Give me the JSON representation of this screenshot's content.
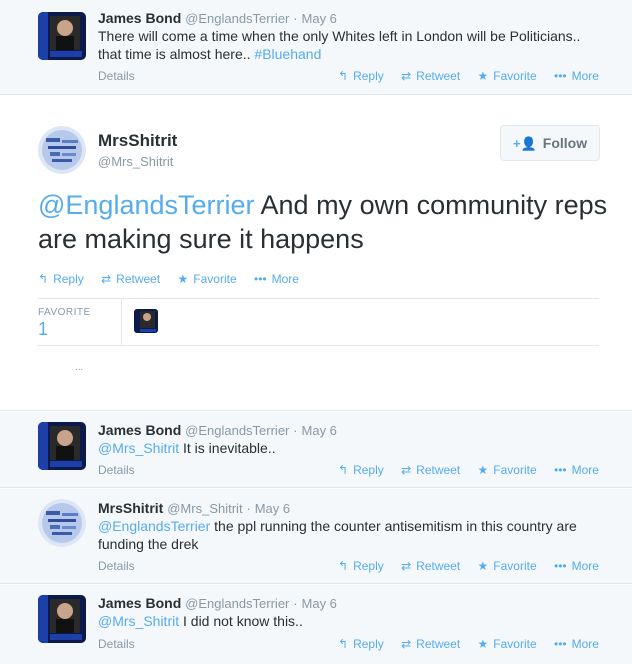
{
  "tweets_top": {
    "name": "James Bond",
    "handle": "@EnglandsTerrier",
    "sep": "·",
    "date": "May 6",
    "text_line1": "There will come a time when the only Whites left in London will be Politicians..",
    "text_line2": "that time is almost here.. ",
    "hashtag": "#Bluehand",
    "details": "Details"
  },
  "actions": {
    "reply": "Reply",
    "retweet": "Retweet",
    "favorite": "Favorite",
    "more": "More"
  },
  "main_tweet": {
    "name": "MrsShitrit",
    "handle": "@Mrs_Shitrit",
    "follow_label": "Follow",
    "mention": "@EnglandsTerrier",
    "text": " And my own community reps are making sure it happens",
    "favorite_label": "FAVORITE",
    "favorite_count": "1",
    "ellipsis": "..."
  },
  "reply1": {
    "name": "James Bond",
    "handle": "@EnglandsTerrier",
    "sep": "·",
    "date": "May 6",
    "mention": "@Mrs_Shitrit",
    "text": " It is inevitable..",
    "details": "Details"
  },
  "reply2": {
    "name": "MrsShitrit",
    "handle": "@Mrs_Shitrit",
    "sep": "·",
    "date": "May 6",
    "mention": "@EnglandsTerrier",
    "text1": " the ppl running the counter antisemitism in this country are",
    "text2": "funding the drek",
    "details": "Details"
  },
  "reply3": {
    "name": "James Bond",
    "handle": "@EnglandsTerrier",
    "sep": "·",
    "date": "May 6",
    "mention": "@Mrs_Shitrit",
    "text": " I did not know this..",
    "details": "Details"
  },
  "colors": {
    "link": "#55acee",
    "muted": "#8899a6",
    "text": "#292f33"
  }
}
